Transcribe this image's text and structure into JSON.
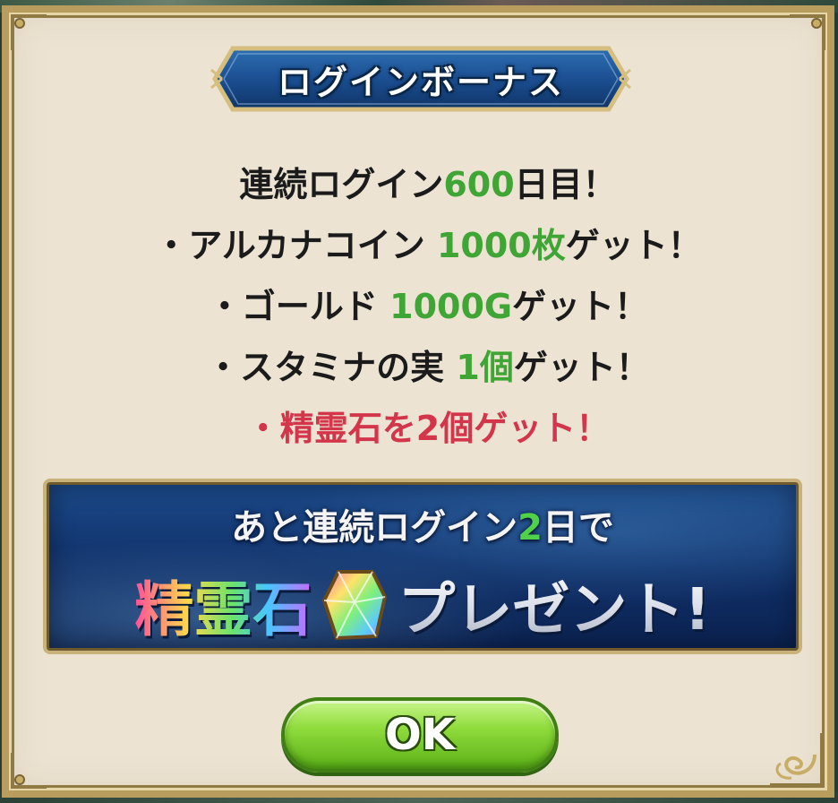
{
  "dialog": {
    "title": "ログインボーナス"
  },
  "messages": {
    "streak_prefix": "連続ログイン",
    "streak_days": "600",
    "streak_suffix": "日目！",
    "reward1_name": "・アルカナコイン ",
    "reward1_amount": "1000枚",
    "reward1_suffix": "ゲット！",
    "reward2_name": "・ゴールド ",
    "reward2_amount": "1000G",
    "reward2_suffix": "ゲット！",
    "reward3_name": "・スタミナの実 ",
    "reward3_amount": "1個",
    "reward3_suffix": "ゲット！",
    "reward4_text": "・精霊石を2個ゲット！"
  },
  "banner": {
    "line1_prefix": "あと連続ログイン",
    "line1_days": "2",
    "line1_suffix": "日で",
    "item_name": "精霊石",
    "item_icon": "spirit-stone-gem-icon",
    "present_text": "プレゼント!"
  },
  "button": {
    "ok_label": "OK"
  },
  "colors": {
    "highlight_green": "#3fa535",
    "highlight_red": "#d3354a",
    "button_green": "#8fdc3c",
    "panel_bg": "#ece3d3",
    "banner_blue": "#0f2e66"
  }
}
